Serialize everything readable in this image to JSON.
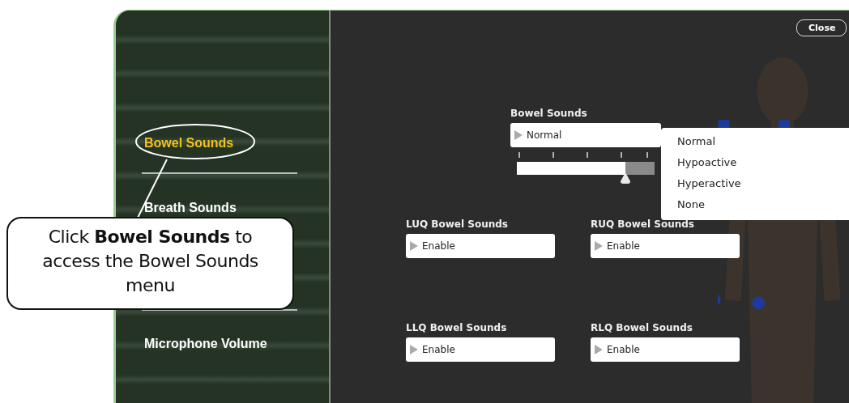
{
  "sidebar": {
    "items": [
      {
        "label": "Bowel Sounds",
        "selected": true
      },
      {
        "label": "Breath Sounds",
        "selected": false
      },
      {
        "label": "Microphone Volume",
        "selected": false
      }
    ]
  },
  "close_button": "Close",
  "bowel_sounds": {
    "label": "Bowel Sounds",
    "value": "Normal",
    "level": 0.79,
    "options": [
      "Normal",
      "Hypoactive",
      "Hyperactive",
      "None"
    ]
  },
  "quadrants": [
    {
      "label": "LUQ Bowel Sounds",
      "value": "Enable"
    },
    {
      "label": "RUQ Bowel Sounds",
      "value": "Enable"
    },
    {
      "label": "LLQ Bowel Sounds",
      "value": "Enable"
    },
    {
      "label": "RLQ Bowel Sounds",
      "value": "Enable"
    }
  ],
  "callout": "Click **Bowel Sounds** to access the Bowel Sounds menu"
}
